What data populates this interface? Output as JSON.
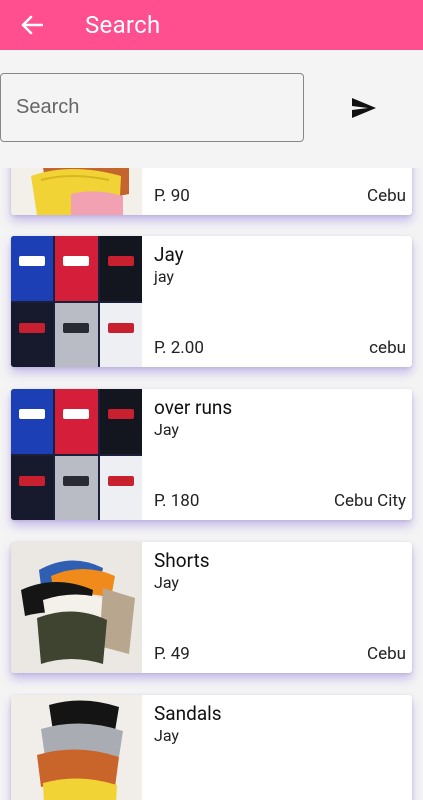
{
  "appbar": {
    "title": "Search",
    "back_icon": "arrow-left-icon"
  },
  "search": {
    "placeholder": "Search",
    "value": "",
    "send_icon": "send-icon"
  },
  "colors": {
    "appbar": "#ff4f8f",
    "shadow": "#7c5ce0"
  },
  "products": [
    {
      "name": "",
      "seller": "",
      "price": "P. 90",
      "location": "Cebu",
      "image": "colorful-shorts"
    },
    {
      "name": "Jay",
      "seller": "jay",
      "price": "P. 2.00",
      "location": "cebu",
      "image": "levis-shirts"
    },
    {
      "name": "over runs",
      "seller": "Jay",
      "price": "P. 180",
      "location": "Cebu City",
      "image": "levis-shirts"
    },
    {
      "name": "Shorts",
      "seller": "Jay",
      "price": "P. 49",
      "location": "Cebu",
      "image": "shorts-pile"
    },
    {
      "name": "Sandals",
      "seller": "Jay",
      "price": "",
      "location": "",
      "image": "colorful-shorts"
    }
  ]
}
